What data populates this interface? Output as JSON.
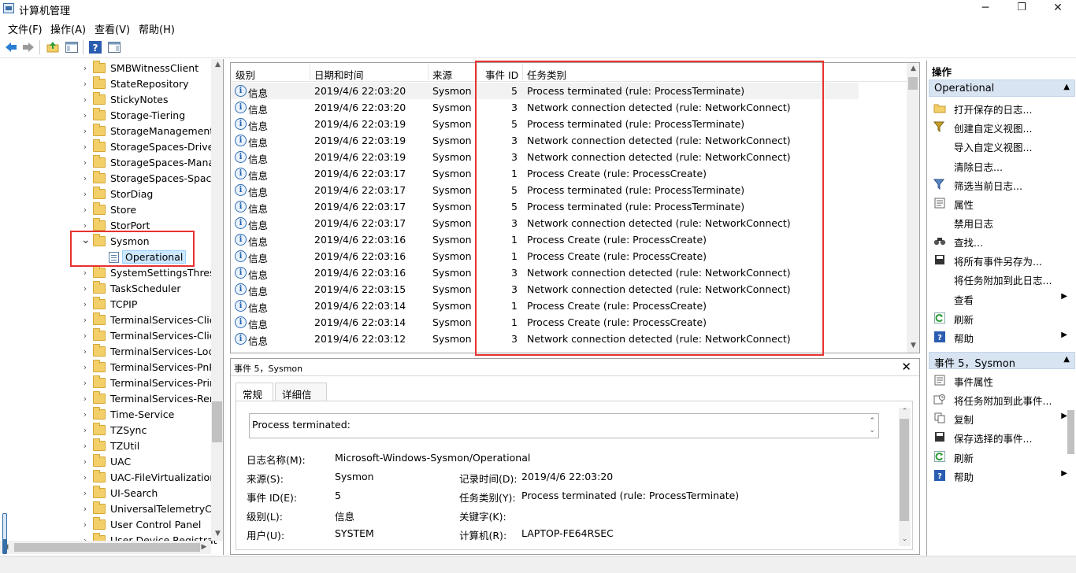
{
  "window": {
    "title": "计算机管理",
    "minimize": "─",
    "maximize": "❐",
    "close": "✕"
  },
  "menu": [
    "文件(F)",
    "操作(A)",
    "查看(V)",
    "帮助(H)"
  ],
  "tree": {
    "items": [
      "SMBWitnessClient",
      "StateRepository",
      "StickyNotes",
      "Storage-Tiering",
      "StorageManagement",
      "StorageSpaces-Driver",
      "StorageSpaces-Mana",
      "StorageSpaces-Space",
      "StorDiag",
      "Store",
      "StorPort",
      "Sysmon",
      "SystemSettingsThresh",
      "TaskScheduler",
      "TCPIP",
      "TerminalServices-Clier",
      "TerminalServices-Clier",
      "TerminalServices-Loca",
      "TerminalServices-PnPI",
      "TerminalServices-Print",
      "TerminalServices-Rem",
      "Time-Service",
      "TZSync",
      "TZUtil",
      "UAC",
      "UAC-FileVirtualization",
      "UI-Search",
      "UniversalTelemetryCli",
      "User Control Panel",
      "User Device Registrat"
    ],
    "sysmon_child": "Operational"
  },
  "list": {
    "headers": {
      "level": "级别",
      "datetime": "日期和时间",
      "source": "来源",
      "event_id": "事件 ID",
      "category": "任务类别"
    },
    "rows": [
      {
        "level": "信息",
        "datetime": "2019/4/6 22:03:20",
        "source": "Sysmon",
        "id": "5",
        "category": "Process terminated (rule: ProcessTerminate)"
      },
      {
        "level": "信息",
        "datetime": "2019/4/6 22:03:20",
        "source": "Sysmon",
        "id": "3",
        "category": "Network connection detected (rule: NetworkConnect)"
      },
      {
        "level": "信息",
        "datetime": "2019/4/6 22:03:19",
        "source": "Sysmon",
        "id": "5",
        "category": "Process terminated (rule: ProcessTerminate)"
      },
      {
        "level": "信息",
        "datetime": "2019/4/6 22:03:19",
        "source": "Sysmon",
        "id": "3",
        "category": "Network connection detected (rule: NetworkConnect)"
      },
      {
        "level": "信息",
        "datetime": "2019/4/6 22:03:19",
        "source": "Sysmon",
        "id": "3",
        "category": "Network connection detected (rule: NetworkConnect)"
      },
      {
        "level": "信息",
        "datetime": "2019/4/6 22:03:17",
        "source": "Sysmon",
        "id": "1",
        "category": "Process Create (rule: ProcessCreate)"
      },
      {
        "level": "信息",
        "datetime": "2019/4/6 22:03:17",
        "source": "Sysmon",
        "id": "5",
        "category": "Process terminated (rule: ProcessTerminate)"
      },
      {
        "level": "信息",
        "datetime": "2019/4/6 22:03:17",
        "source": "Sysmon",
        "id": "5",
        "category": "Process terminated (rule: ProcessTerminate)"
      },
      {
        "level": "信息",
        "datetime": "2019/4/6 22:03:17",
        "source": "Sysmon",
        "id": "3",
        "category": "Network connection detected (rule: NetworkConnect)"
      },
      {
        "level": "信息",
        "datetime": "2019/4/6 22:03:16",
        "source": "Sysmon",
        "id": "1",
        "category": "Process Create (rule: ProcessCreate)"
      },
      {
        "level": "信息",
        "datetime": "2019/4/6 22:03:16",
        "source": "Sysmon",
        "id": "1",
        "category": "Process Create (rule: ProcessCreate)"
      },
      {
        "level": "信息",
        "datetime": "2019/4/6 22:03:16",
        "source": "Sysmon",
        "id": "3",
        "category": "Network connection detected (rule: NetworkConnect)"
      },
      {
        "level": "信息",
        "datetime": "2019/4/6 22:03:15",
        "source": "Sysmon",
        "id": "3",
        "category": "Network connection detected (rule: NetworkConnect)"
      },
      {
        "level": "信息",
        "datetime": "2019/4/6 22:03:14",
        "source": "Sysmon",
        "id": "1",
        "category": "Process Create (rule: ProcessCreate)"
      },
      {
        "level": "信息",
        "datetime": "2019/4/6 22:03:14",
        "source": "Sysmon",
        "id": "1",
        "category": "Process Create (rule: ProcessCreate)"
      },
      {
        "level": "信息",
        "datetime": "2019/4/6 22:03:12",
        "source": "Sysmon",
        "id": "3",
        "category": "Network connection detected (rule: NetworkConnect)"
      }
    ]
  },
  "detail": {
    "title": "事件 5，Sysmon",
    "tabs": [
      "常规",
      "详细信息"
    ],
    "message": "Process terminated:",
    "labels": {
      "log_name": "日志名称(M):",
      "source": "来源(S):",
      "event_id": "事件 ID(E):",
      "level": "级别(L):",
      "user": "用户(U):",
      "logged": "记录时间(D):",
      "task_category": "任务类别(Y):",
      "keywords": "关键字(K):",
      "computer": "计算机(R):"
    },
    "values": {
      "log_name": "Microsoft-Windows-Sysmon/Operational",
      "source": "Sysmon",
      "event_id": "5",
      "level": "信息",
      "user": "SYSTEM",
      "logged": "2019/4/6 22:03:20",
      "task_category": "Process terminated (rule: ProcessTerminate)",
      "keywords": "",
      "computer": "LAPTOP-FE64RSEC"
    }
  },
  "actions": {
    "title": "操作",
    "section1": "Operational",
    "items1": [
      "打开保存的日志...",
      "创建自定义视图...",
      "导入自定义视图...",
      "清除日志...",
      "筛选当前日志...",
      "属性",
      "禁用日志",
      "查找...",
      "将所有事件另存为...",
      "将任务附加到此日志...",
      "查看",
      "刷新",
      "帮助"
    ],
    "section2": "事件 5，Sysmon",
    "items2": [
      "事件属性",
      "将任务附加到此事件...",
      "复制",
      "保存选择的事件...",
      "刷新",
      "帮助"
    ]
  },
  "colors": {
    "highlight_red": "#e8312f",
    "section_blue": "#d8e4f2",
    "selected_blue": "#cce8ff"
  }
}
